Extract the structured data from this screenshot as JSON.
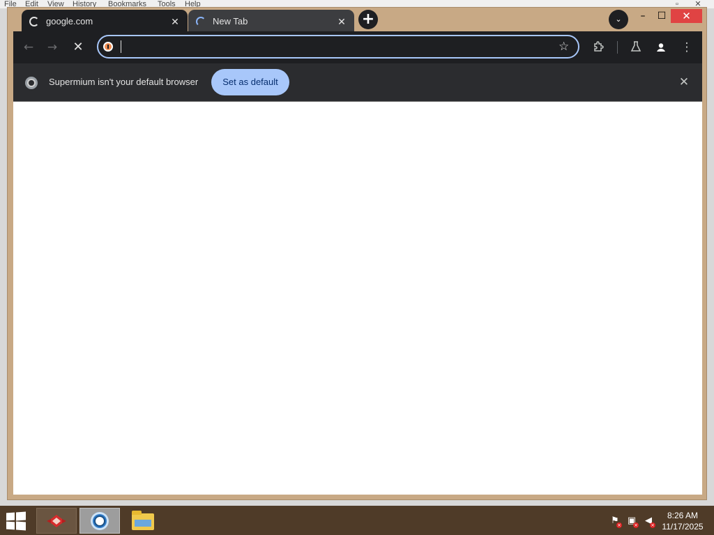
{
  "background_app": {
    "menu": [
      "File",
      "Edit",
      "View",
      "History",
      "Bookmarks",
      "Tools",
      "Help"
    ]
  },
  "tabs": [
    {
      "title": "google.com",
      "close": "✕",
      "state": "loading",
      "active": true
    },
    {
      "title": "New Tab",
      "close": "✕",
      "state": "loading",
      "active": false
    }
  ],
  "titlebar": {
    "new_tab_icon": "+",
    "tab_search_icon": "⌄",
    "minimize": "–",
    "maximize": "☐",
    "close": "✕"
  },
  "toolbar": {
    "back_icon": "←",
    "forward_icon": "→",
    "stop_icon": "✕",
    "address_value": "",
    "bookmark_icon": "☆",
    "extensions_icon": "puzzle",
    "labs_icon": "flask",
    "profile_icon": "person",
    "menu_icon": "⋮"
  },
  "infobar": {
    "message": "Supermium isn't your default browser",
    "button_label": "Set as default",
    "close_icon": "✕"
  },
  "taskbar": {
    "apps": [
      "app-icon-red",
      "browser-icon",
      "file-explorer-icon"
    ],
    "clock_time": "8:26 AM",
    "clock_date": "11/17/2025"
  },
  "colors": {
    "window_frame": "#c8a985",
    "toolbar_bg": "#1e1f22",
    "infobar_bg": "#2b2c2f",
    "accent": "#a8c7fa",
    "taskbar_bg": "#4f3b28",
    "close_red": "#e04343"
  }
}
